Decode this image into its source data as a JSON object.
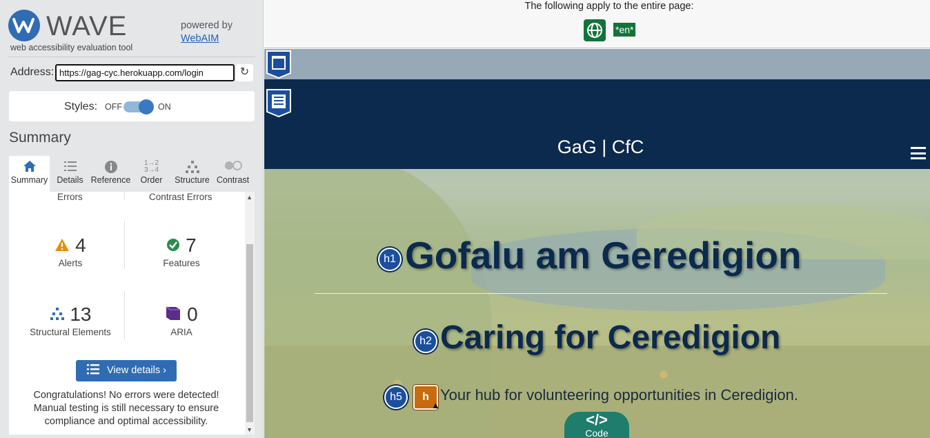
{
  "wave": {
    "logo_text": "WAVE",
    "subtitle": "web accessibility evaluation tool",
    "powered_by": "powered by",
    "webaim_link": "WebAIM",
    "address_label": "Address:",
    "address_value": "https://gag-cyc.herokuapp.com/login",
    "styles_label": "Styles:",
    "styles_off": "OFF",
    "styles_on": "ON",
    "summary_heading": "Summary",
    "tabs": [
      {
        "label": "Summary",
        "icon": "home-icon"
      },
      {
        "label": "Details",
        "icon": "list-icon"
      },
      {
        "label": "Reference",
        "icon": "info-icon"
      },
      {
        "label": "Order",
        "icon": "order-icon"
      },
      {
        "label": "Structure",
        "icon": "structure-icon"
      },
      {
        "label": "Contrast",
        "icon": "contrast-icon"
      }
    ],
    "summary": {
      "errors_label": "Errors",
      "contrast_errors_label": "Contrast Errors",
      "alerts": {
        "count": "4",
        "label": "Alerts"
      },
      "features": {
        "count": "7",
        "label": "Features"
      },
      "structural": {
        "count": "13",
        "label": "Structural Elements"
      },
      "aria": {
        "count": "0",
        "label": "ARIA"
      }
    },
    "view_details": "View details ›",
    "congrats": "Congratulations! No errors were detected! Manual testing is still necessary to ensure compliance and optimal accessibility."
  },
  "page": {
    "apply_text": "The following apply to the entire page:",
    "lang_badge": "*en*",
    "brand": "GaG | CfC",
    "h1": "Gofalu am Geredigion",
    "h1_tag": "h1",
    "h2": "Caring for Ceredigion",
    "h2_tag": "h2",
    "h5": "Your hub for volunteering opportunities in Ceredigion.",
    "h5_tag": "h5",
    "alert_tag": "h",
    "code_label": "Code",
    "code_icon": "</>"
  },
  "colors": {
    "wave_blue": "#2f6cb3",
    "navbar": "#0b2a4d",
    "feature_green": "#13733a",
    "alert_orange": "#c96a0c",
    "code_teal": "#1f7d6d"
  }
}
